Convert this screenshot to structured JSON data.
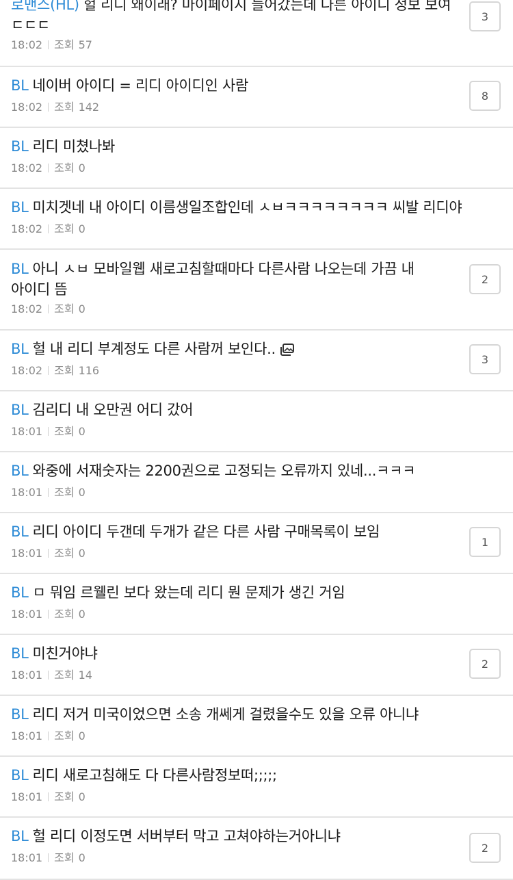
{
  "posts": [
    {
      "category": "로맨스(HL)",
      "title": "헐 리디 왜이래? 마이페이지 들어갔는데 다른 아이디 정보 보여 ㄷㄷㄷ",
      "time": "18:02",
      "views_label": "조회",
      "views": "57",
      "comments": "3"
    },
    {
      "category": "BL",
      "title": "네이버 아이디 = 리디 아이디인 사람",
      "time": "18:02",
      "views_label": "조회",
      "views": "142",
      "comments": "8"
    },
    {
      "category": "BL",
      "title": "리디 미쳤나봐",
      "time": "18:02",
      "views_label": "조회",
      "views": "0",
      "comments": ""
    },
    {
      "category": "BL",
      "title": "미치겟네 내 아이디 이름생일조합인데 ㅅㅂㅋㅋㅋㅋㅋㅋㅋㅋ 씨발 리디야",
      "time": "18:02",
      "views_label": "조회",
      "views": "0",
      "comments": ""
    },
    {
      "category": "BL",
      "title": "아니 ㅅㅂ 모바일웹 새로고침할때마다 다른사람 나오는데 가끔 내 아이디 뜸",
      "time": "18:02",
      "views_label": "조회",
      "views": "0",
      "comments": "2"
    },
    {
      "category": "BL",
      "title": "헐 내 리디 부계정도 다른 사람꺼 보인다..",
      "time": "18:02",
      "views_label": "조회",
      "views": "116",
      "comments": "3",
      "has_image": true
    },
    {
      "category": "BL",
      "title": "김리디 내 오만권 어디 갔어",
      "time": "18:01",
      "views_label": "조회",
      "views": "0",
      "comments": ""
    },
    {
      "category": "BL",
      "title": "와중에 서재숫자는 2200권으로 고정되는 오류까지 있네...ㅋㅋㅋ",
      "time": "18:01",
      "views_label": "조회",
      "views": "0",
      "comments": ""
    },
    {
      "category": "BL",
      "title": "리디 아이디 두갠데 두개가 같은 다른 사람 구매목록이 보임",
      "time": "18:01",
      "views_label": "조회",
      "views": "0",
      "comments": "1"
    },
    {
      "category": "BL",
      "title": "ㅁ 뭐임 르웰린 보다 왔는데 리디 뭔 문제가 생긴 거임",
      "time": "18:01",
      "views_label": "조회",
      "views": "0",
      "comments": ""
    },
    {
      "category": "BL",
      "title": "미친거야냐",
      "time": "18:01",
      "views_label": "조회",
      "views": "14",
      "comments": "2"
    },
    {
      "category": "BL",
      "title": "리디 저거 미국이었으면 소송 개쎄게 걸렸을수도 있을 오류 아니냐",
      "time": "18:01",
      "views_label": "조회",
      "views": "0",
      "comments": ""
    },
    {
      "category": "BL",
      "title": "리디 새로고침해도 다 다른사람정보떠;;;;;",
      "time": "18:01",
      "views_label": "조회",
      "views": "0",
      "comments": ""
    },
    {
      "category": "BL",
      "title": "헐 리디 이정도면 서버부터 막고 고쳐야하는거아니냐",
      "time": "18:01",
      "views_label": "조회",
      "views": "0",
      "comments": "2"
    }
  ],
  "colors": {
    "category": "#2d8bd6",
    "meta": "#8a8a8a",
    "divider": "#e3e3e3"
  },
  "icons": {
    "image_attachment": "image-attachment-icon"
  }
}
